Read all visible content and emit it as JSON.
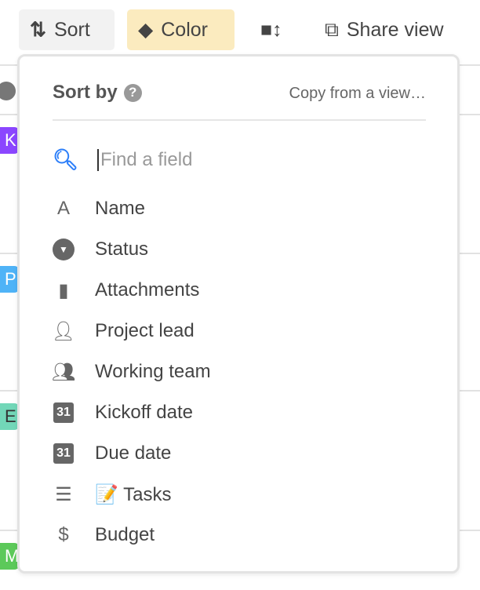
{
  "toolbar": {
    "sort": "Sort",
    "color": "Color",
    "share": "Share view"
  },
  "rows": [
    "K",
    "P",
    "E",
    "M"
  ],
  "colors": {
    "color_active_bg": "#fbebbf",
    "sort_bg": "#f2f2f2",
    "search_icon": "#2d7ff9"
  },
  "popover": {
    "title": "Sort by",
    "copy": "Copy from a view…",
    "search_placeholder": "Find a field",
    "fields": [
      {
        "label": "Name",
        "icon": "text-icon"
      },
      {
        "label": "Status",
        "icon": "single-select-icon"
      },
      {
        "label": "Attachments",
        "icon": "file-icon"
      },
      {
        "label": "Project lead",
        "icon": "user-icon"
      },
      {
        "label": "Working team",
        "icon": "users-icon"
      },
      {
        "label": "Kickoff date",
        "icon": "calendar-icon"
      },
      {
        "label": "Due date",
        "icon": "calendar-icon"
      },
      {
        "label": "📝 Tasks",
        "icon": "rollup-icon"
      },
      {
        "label": "Budget",
        "icon": "currency-icon"
      }
    ]
  }
}
